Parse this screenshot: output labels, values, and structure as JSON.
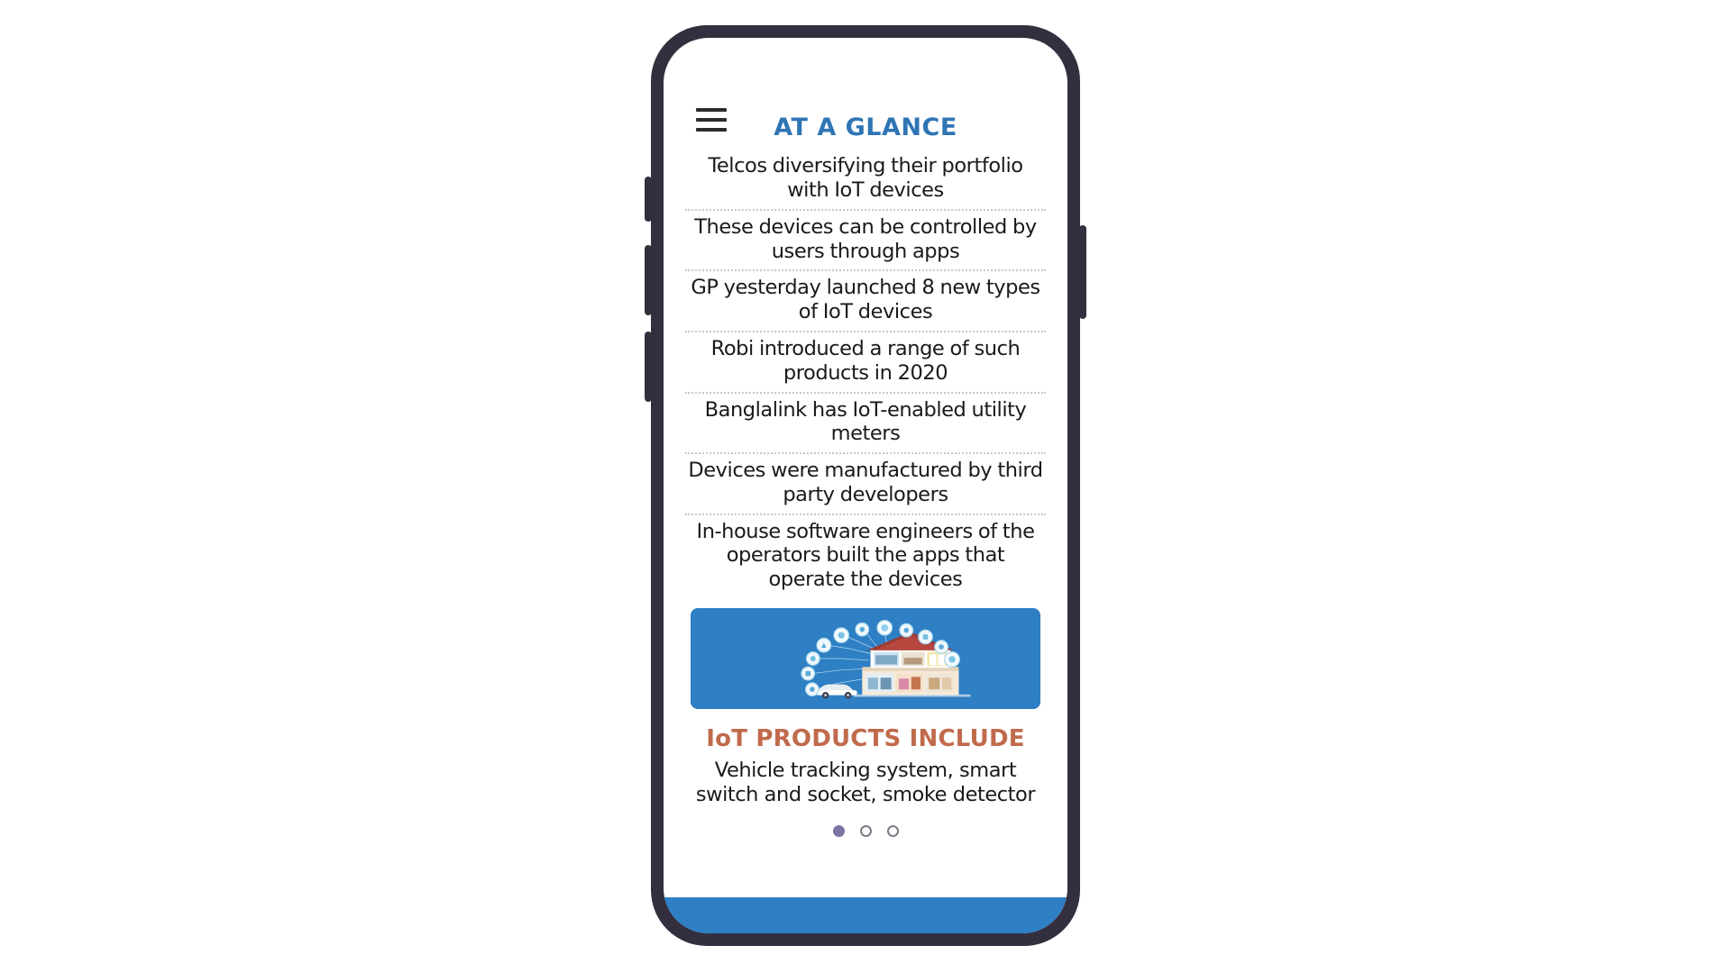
{
  "screen": {
    "menu_icon": "hamburger-menu-icon",
    "glance_title": "AT A GLANCE",
    "facts": [
      "Telcos diversifying their portfolio with IoT devices",
      "These devices can be controlled by users through apps",
      "GP yesterday launched 8 new types of IoT devices",
      "Robi introduced a range of such products in 2020",
      "Banglalink has IoT-enabled utility meters",
      "Devices were manufactured by third party developers",
      "In-house software engineers of the operators built the apps that operate the devices"
    ],
    "banner": {
      "illustration_name": "smart-home-iot-illustration",
      "background_color": "#2e7fc4"
    },
    "products_title": "IoT PRODUCTS INCLUDE",
    "products_body": "Vehicle tracking system, smart switch and socket, smoke detector",
    "pagination": {
      "total": 3,
      "active_index": 0
    },
    "colors": {
      "title_blue": "#2f75b5",
      "products_orange": "#c06a4c",
      "banner_blue": "#2e7fc4",
      "footer_blue": "#2e7fc4",
      "device_frame": "#332f3f",
      "dot_active": "#7a75a3",
      "dot_inactive": "#7d7d88"
    }
  }
}
